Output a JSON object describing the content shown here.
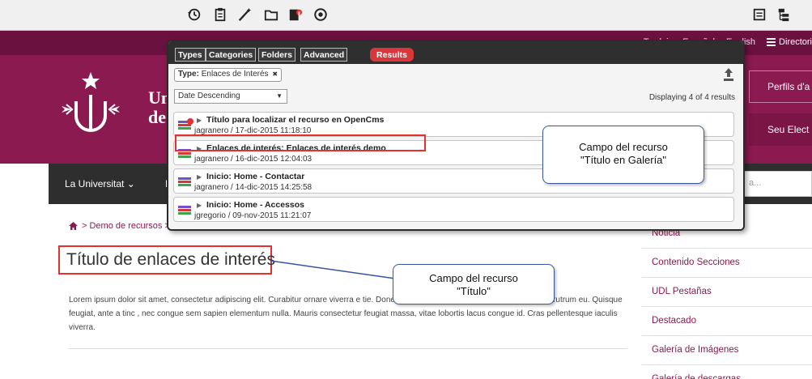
{
  "toolbar": {
    "buttons": [
      {
        "icon": "history-icon"
      },
      {
        "icon": "clipboard-icon"
      },
      {
        "icon": "magic-wand-icon"
      },
      {
        "icon": "folder-icon"
      },
      {
        "icon": "page-info-icon"
      },
      {
        "icon": "target-icon"
      }
    ],
    "right_buttons": [
      {
        "icon": "list-icon"
      },
      {
        "icon": "sitemap-icon"
      }
    ]
  },
  "topbar": {
    "links": [
      "Traduir",
      "Español",
      "English"
    ],
    "directory": "Directori"
  },
  "header": {
    "brand_line1": "Un",
    "brand_line2": "de",
    "button1": "Perfils d'a",
    "button2": "Seu Elect"
  },
  "nav": {
    "items": [
      "La Universitat ⌄",
      "E"
    ],
    "search_placeholder": "a..."
  },
  "breadcrumb": {
    "home_icon": "home-icon",
    "items": [
      "> Demo de recursos >"
    ]
  },
  "content": {
    "title": "Título de enlaces de interés",
    "lorem": "Lorem ipsum dolor sit amet, consectetur adipiscing elit. Curabitur ornare viverra e                                                           tie. Donec pretium vulputate felis, quis venenatis nisi rutrum eu. Quisque feugiat, ante a tinc                                                        , nec congue sem sapien elementum nulla. Mauris consectetur feugiat massa, vitae lobortis lacus congue id. Cras pellentesque iaculis viverra."
  },
  "side_menu": [
    "Noticia",
    "Contenido Secciones",
    "UDL Pestañas",
    "Destacado",
    "Galería de Imágenes",
    "Galería de descargas"
  ],
  "gallery": {
    "tabs": [
      "Types",
      "Categories",
      "Folders",
      "Advanced"
    ],
    "results_tab": "Results",
    "filter_label": "Type:",
    "filter_value": "Enlaces de Interés",
    "filter_close": "✖",
    "sort": "Date Descending",
    "count": "Displaying 4 of 4 results",
    "results": [
      {
        "title": "Título para localizar el recurso en OpenCms",
        "meta": "jagranero / 17-dic-2015 11:18:10"
      },
      {
        "title": "Enlaces de interés: Enlaces de interés demo",
        "meta": "jagranero / 16-dic-2015 12:04:03"
      },
      {
        "title": "Inicio: Home - Contactar",
        "meta": "jagranero / 14-dic-2015 14:25:58"
      },
      {
        "title": "Inicio: Home - Accessos",
        "meta": "jgregorio / 09-nov-2015 11:21:07"
      }
    ]
  },
  "callouts": {
    "gallery_title": [
      "Campo del recurso",
      "\"Título en Galería\""
    ],
    "title": [
      "Campo del recurso",
      "\"Título\""
    ]
  },
  "colors": {
    "brand": "#8a1a4f",
    "topbar": "#6b1140",
    "highlight": "#e53030",
    "callout_border": "#3a55a0"
  }
}
